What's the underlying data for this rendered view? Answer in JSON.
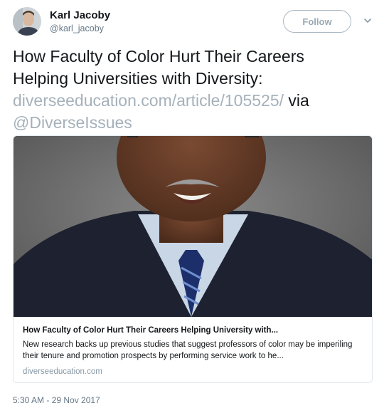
{
  "author": {
    "display_name": "Karl Jacoby",
    "handle": "@karl_jacoby"
  },
  "follow_label": "Follow",
  "tweet": {
    "text_before": "How Faculty of Color Hurt Their Careers Helping Universities with Diversity: ",
    "link": "diverseeducation.com/article/105525/",
    "text_middle": " via ",
    "mention": "@DiverseIssues"
  },
  "card": {
    "title": "How Faculty of Color Hurt Their Careers Helping University with...",
    "description": "New research backs up previous studies that suggest professors of color may be imperiling their tenure and promotion prospects by performing service work to he...",
    "domain": "diverseeducation.com"
  },
  "timestamp": "5:30 AM - 29 Nov 2017",
  "colors": {
    "text": "#14171a",
    "link_muted": "#a5b1ba",
    "secondary": "#657786",
    "border": "#e1e8ed"
  }
}
